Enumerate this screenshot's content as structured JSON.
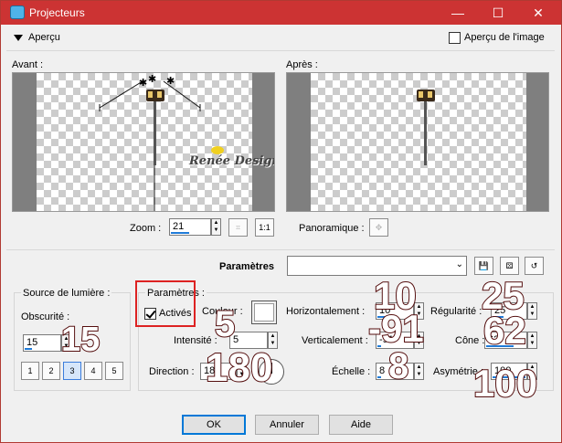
{
  "window": {
    "title": "Projecteurs",
    "minimize": "—",
    "maximize": "☐",
    "close": "✕"
  },
  "preview": {
    "toggle_label": "Aperçu",
    "show_image_label": "Aperçu de l'image",
    "before_label": "Avant :",
    "after_label": "Après :",
    "watermark": "Renée Design",
    "zoom_label": "Zoom :",
    "zoom_value": "21",
    "zoom_fit_label": "1:1",
    "pan_label": "Panoramique :"
  },
  "presets": {
    "label": "Paramètres",
    "value": ""
  },
  "light_source": {
    "group_label": "Source de lumière :",
    "darkness_label": "Obscurité :",
    "darkness_value": "15",
    "source_buttons": [
      "1",
      "2",
      "3",
      "4",
      "5"
    ]
  },
  "params": {
    "group_label": "Paramètres :",
    "enabled_label": "Activés",
    "enabled": true,
    "color_label": "Couleur :",
    "color_value": "#ffffff",
    "intensity_label": "Intensité :",
    "intensity_value": "5",
    "direction_label": "Direction :",
    "direction_value": "180",
    "horizontal_label": "Horizontalement :",
    "horizontal_value": "10",
    "vertical_label": "Verticalement :",
    "vertical_value": "-91",
    "scale_label": "Échelle :",
    "scale_value": "8",
    "regularity_label": "Régularité :",
    "regularity_value": "25",
    "cone_label": "Cône :",
    "cone_value": "62",
    "asymmetry_label": "Asymétrie :",
    "asymmetry_value": "100"
  },
  "overlay_values": {
    "darkness": "15",
    "intensity": "5",
    "direction": "180",
    "horizontal": "10",
    "vertical": "-91",
    "scale": "8",
    "regularity": "25",
    "cone": "62",
    "asymmetry": "100"
  },
  "buttons": {
    "ok": "OK",
    "cancel": "Annuler",
    "help": "Aide"
  }
}
